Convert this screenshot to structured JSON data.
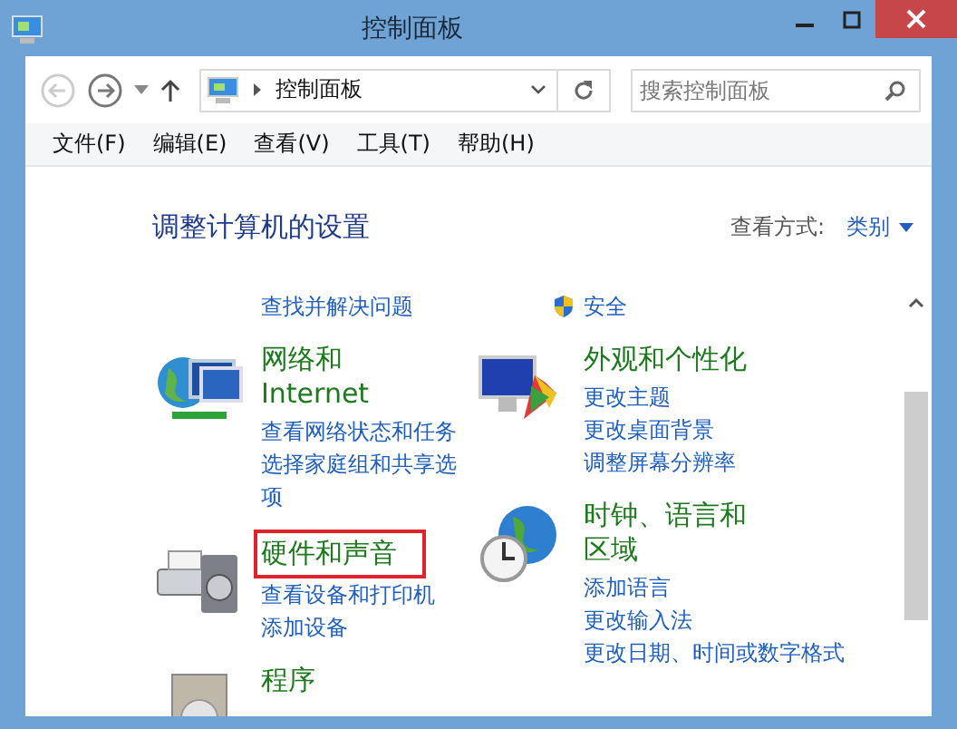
{
  "window": {
    "title": "控制面板"
  },
  "address_bar": {
    "path": "控制面板"
  },
  "search": {
    "placeholder": "搜索控制面板"
  },
  "menu": [
    "文件(F)",
    "编辑(E)",
    "查看(V)",
    "工具(T)",
    "帮助(H)"
  ],
  "heading": "调整计算机的设置",
  "view_by": {
    "label": "查看方式:",
    "value": "类别"
  },
  "left_column": [
    {
      "kind": "links",
      "links": [
        "查找并解决问题"
      ]
    },
    {
      "kind": "category",
      "title": "网络和 Internet",
      "highlighted": false,
      "links": [
        "查看网络状态和任务",
        "选择家庭组和共享选项"
      ]
    },
    {
      "kind": "category",
      "title": "硬件和声音",
      "highlighted": true,
      "links": [
        "查看设备和打印机",
        "添加设备"
      ]
    },
    {
      "kind": "category",
      "title": "程序",
      "highlighted": false
    }
  ],
  "right_column": [
    {
      "kind": "links",
      "links": [
        "安全"
      ]
    },
    {
      "kind": "category",
      "title": "外观和个性化",
      "highlighted": false,
      "links": [
        "更改主题",
        "更改桌面背景",
        "调整屏幕分辨率"
      ]
    },
    {
      "kind": "category",
      "title": "时钟、语言和区域",
      "highlighted": false,
      "links": [
        "添加语言",
        "更改输入法",
        "更改日期、时间或数字格式"
      ]
    }
  ]
}
